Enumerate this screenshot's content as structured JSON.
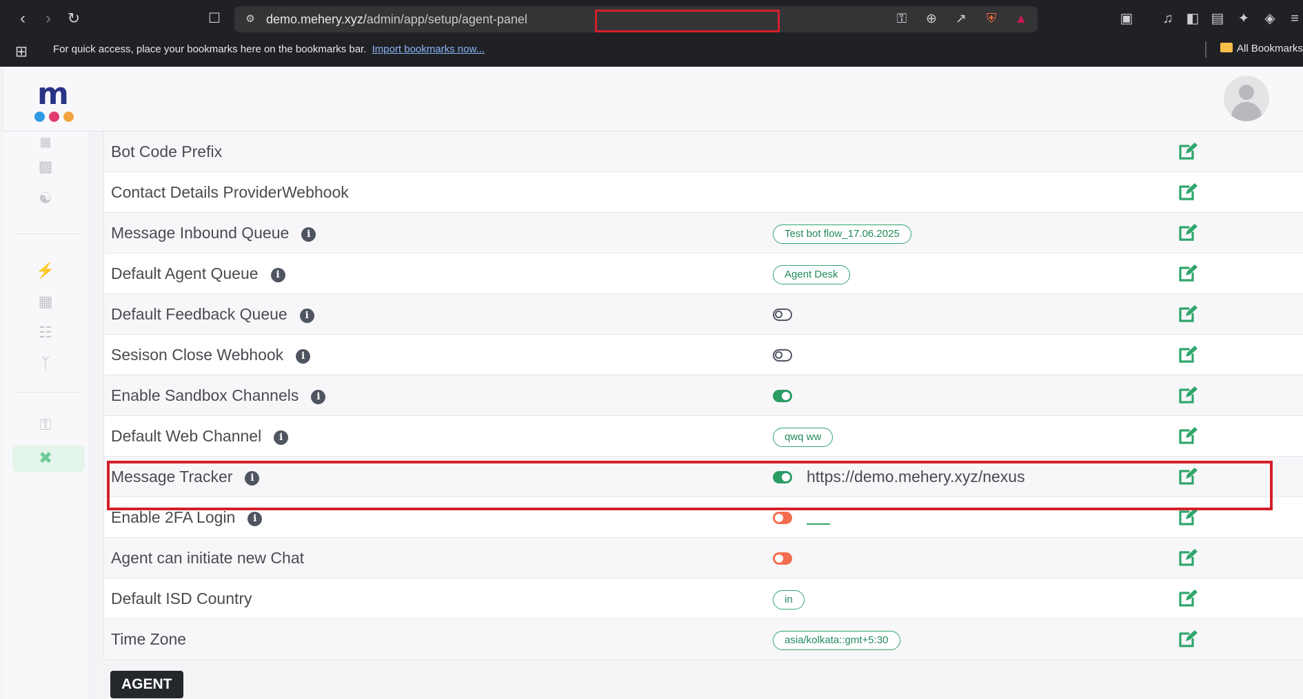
{
  "browser": {
    "url_host": "demo.mehery.xyz/",
    "url_path": "admin/app/setup/agent-panel",
    "bookmarks_prompt": "For quick access, place your bookmarks here on the bookmarks bar.",
    "import_link": "Import bookmarks now...",
    "all_bookmarks": "All Bookmarks"
  },
  "logo": {
    "letter": "m",
    "dot_colors": [
      "#2f9be3",
      "#e23b6f",
      "#f0a53d"
    ]
  },
  "colors": {
    "accent": "#2fa66b",
    "toggle_on": "#2b9c64",
    "toggle_warn": "#f26d4f",
    "highlight": "#d4202a"
  },
  "settings": [
    {
      "label": "Bot Code Prefix",
      "info": false,
      "value_type": "none"
    },
    {
      "label": "Contact Details ProviderWebhook",
      "info": false,
      "value_type": "none"
    },
    {
      "label": "Message Inbound Queue",
      "info": true,
      "value_type": "badge",
      "value": "Test bot flow_17.06.2025"
    },
    {
      "label": "Default Agent Queue",
      "info": true,
      "value_type": "badge",
      "value": "Agent Desk"
    },
    {
      "label": "Default Feedback Queue",
      "info": true,
      "value_type": "toggle",
      "toggle": "off"
    },
    {
      "label": "Sesison Close Webhook",
      "info": true,
      "value_type": "toggle",
      "toggle": "off"
    },
    {
      "label": "Enable Sandbox Channels",
      "info": true,
      "value_type": "toggle",
      "toggle": "on"
    },
    {
      "label": "Default Web Channel",
      "info": true,
      "value_type": "badge",
      "value": "qwq ww"
    },
    {
      "label": "Message Tracker",
      "info": true,
      "value_type": "toggle_text",
      "toggle": "on",
      "value": "https://demo.mehery.xyz/nexus"
    },
    {
      "label": "Enable 2FA Login",
      "info": true,
      "value_type": "toggle_dash",
      "toggle": "warn"
    },
    {
      "label": "Agent can initiate new Chat",
      "info": false,
      "value_type": "toggle",
      "toggle": "warn"
    },
    {
      "label": "Default ISD Country",
      "info": false,
      "value_type": "badge",
      "value": "in"
    },
    {
      "label": "Time Zone",
      "info": false,
      "value_type": "badge",
      "value": "asia/kolkata::gmt+5:30"
    }
  ],
  "section_button": "AGENT",
  "icons": {
    "info": "i",
    "edit": "edit-icon"
  }
}
